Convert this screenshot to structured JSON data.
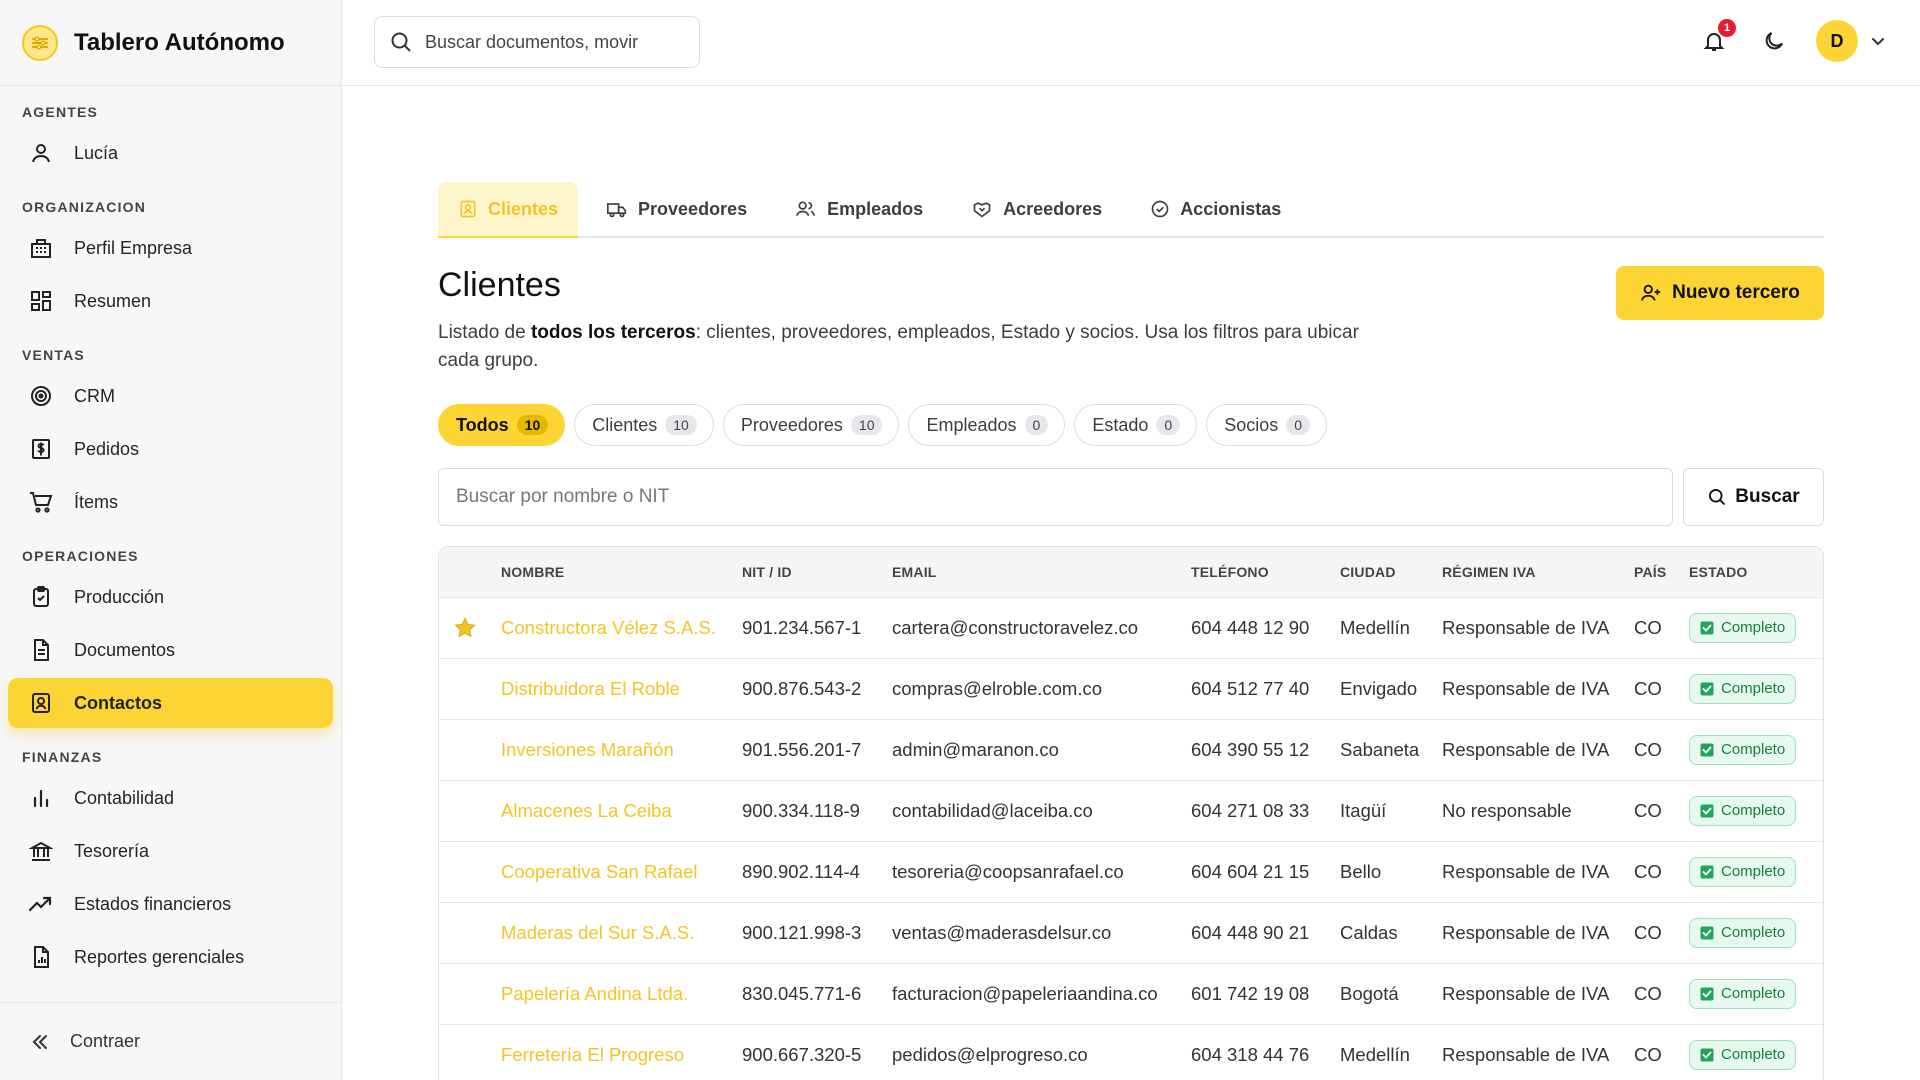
{
  "app": {
    "title": "Tablero Autónomo"
  },
  "topbar": {
    "search_placeholder": "Buscar documentos, movir",
    "notifications_count": "1",
    "user_initial": "D"
  },
  "sidebar": {
    "sections": [
      {
        "label": "AGENTES",
        "items": [
          {
            "label": "Lucía",
            "icon": "user-icon"
          }
        ]
      },
      {
        "label": "ORGANIZACION",
        "items": [
          {
            "label": "Perfil Empresa",
            "icon": "building-icon"
          },
          {
            "label": "Resumen",
            "icon": "dashboard-icon"
          }
        ]
      },
      {
        "label": "VENTAS",
        "items": [
          {
            "label": "CRM",
            "icon": "target-icon"
          },
          {
            "label": "Pedidos",
            "icon": "invoice-dollar-icon"
          },
          {
            "label": "Ítems",
            "icon": "cart-icon"
          }
        ]
      },
      {
        "label": "OPERACIONES",
        "items": [
          {
            "label": "Producción",
            "icon": "clipboard-check-icon"
          },
          {
            "label": "Documentos",
            "icon": "document-icon"
          },
          {
            "label": "Contactos",
            "icon": "contact-card-icon",
            "active": true
          }
        ]
      },
      {
        "label": "FINANZAS",
        "items": [
          {
            "label": "Contabilidad",
            "icon": "bar-chart-icon"
          },
          {
            "label": "Tesorería",
            "icon": "bank-icon"
          },
          {
            "label": "Estados financieros",
            "icon": "trend-up-icon"
          },
          {
            "label": "Reportes gerenciales",
            "icon": "report-icon"
          }
        ]
      }
    ],
    "collapse_label": "Contraer"
  },
  "tabs": [
    {
      "label": "Clientes",
      "icon": "contact-card-icon",
      "active": true
    },
    {
      "label": "Proveedores",
      "icon": "truck-icon"
    },
    {
      "label": "Empleados",
      "icon": "users-icon"
    },
    {
      "label": "Acreedores",
      "icon": "handshake-icon"
    },
    {
      "label": "Accionistas",
      "icon": "badge-check-icon"
    }
  ],
  "page": {
    "title": "Clientes",
    "desc_prefix": "Listado de ",
    "desc_bold": "todos los terceros",
    "desc_suffix": ": clientes, proveedores, empleados, Estado y socios. Usa los filtros para ubicar cada grupo.",
    "new_button": "Nuevo tercero"
  },
  "chips": [
    {
      "label": "Todos",
      "count": "10",
      "active": true
    },
    {
      "label": "Clientes",
      "count": "10"
    },
    {
      "label": "Proveedores",
      "count": "10"
    },
    {
      "label": "Empleados",
      "count": "0"
    },
    {
      "label": "Estado",
      "count": "0"
    },
    {
      "label": "Socios",
      "count": "0"
    }
  ],
  "filter": {
    "placeholder": "Buscar por nombre o NIT",
    "button": "Buscar"
  },
  "table": {
    "headers": [
      "",
      "NOMBRE",
      "NIT / ID",
      "EMAIL",
      "TELÉFONO",
      "CIUDAD",
      "RÉGIMEN IVA",
      "PAÍS",
      "ESTADO"
    ],
    "rows": [
      {
        "starred": true,
        "name": "Constructora Vélez S.A.S.",
        "nit": "901.234.567-1",
        "email": "cartera@constructoravelez.co",
        "phone": "604 448 12 90",
        "city": "Medellín",
        "regime": "Responsable de IVA",
        "country": "CO",
        "status": "Completo"
      },
      {
        "starred": false,
        "name": "Distribuidora El Roble",
        "nit": "900.876.543-2",
        "email": "compras@elroble.com.co",
        "phone": "604 512 77 40",
        "city": "Envigado",
        "regime": "Responsable de IVA",
        "country": "CO",
        "status": "Completo"
      },
      {
        "starred": false,
        "name": "Inversiones Marañón",
        "nit": "901.556.201-7",
        "email": "admin@maranon.co",
        "phone": "604 390 55 12",
        "city": "Sabaneta",
        "regime": "Responsable de IVA",
        "country": "CO",
        "status": "Completo"
      },
      {
        "starred": false,
        "name": "Almacenes La Ceiba",
        "nit": "900.334.118-9",
        "email": "contabilidad@laceiba.co",
        "phone": "604 271 08 33",
        "city": "Itagüí",
        "regime": "No responsable",
        "country": "CO",
        "status": "Completo"
      },
      {
        "starred": false,
        "name": "Cooperativa San Rafael",
        "nit": "890.902.114-4",
        "email": "tesoreria@coopsanrafael.co",
        "phone": "604 604 21 15",
        "city": "Bello",
        "regime": "Responsable de IVA",
        "country": "CO",
        "status": "Completo"
      },
      {
        "starred": false,
        "name": "Maderas del Sur S.A.S.",
        "nit": "900.121.998-3",
        "email": "ventas@maderasdelsur.co",
        "phone": "604 448 90 21",
        "city": "Caldas",
        "regime": "Responsable de IVA",
        "country": "CO",
        "status": "Completo"
      },
      {
        "starred": false,
        "name": "Papelería Andina Ltda.",
        "nit": "830.045.771-6",
        "email": "facturacion@papeleriaandina.co",
        "phone": "601 742 19 08",
        "city": "Bogotá",
        "regime": "Responsable de IVA",
        "country": "CO",
        "status": "Completo"
      },
      {
        "starred": false,
        "name": "Ferretería El Progreso",
        "nit": "900.667.320-5",
        "email": "pedidos@elprogreso.co",
        "phone": "604 318 44 76",
        "city": "Medellín",
        "regime": "Responsable de IVA",
        "country": "CO",
        "status": "Completo"
      }
    ]
  },
  "colors": {
    "accent": "#fcd535",
    "name_link": "#f2c525",
    "status_green": "#16803c",
    "notification_red": "#e11d2e"
  }
}
